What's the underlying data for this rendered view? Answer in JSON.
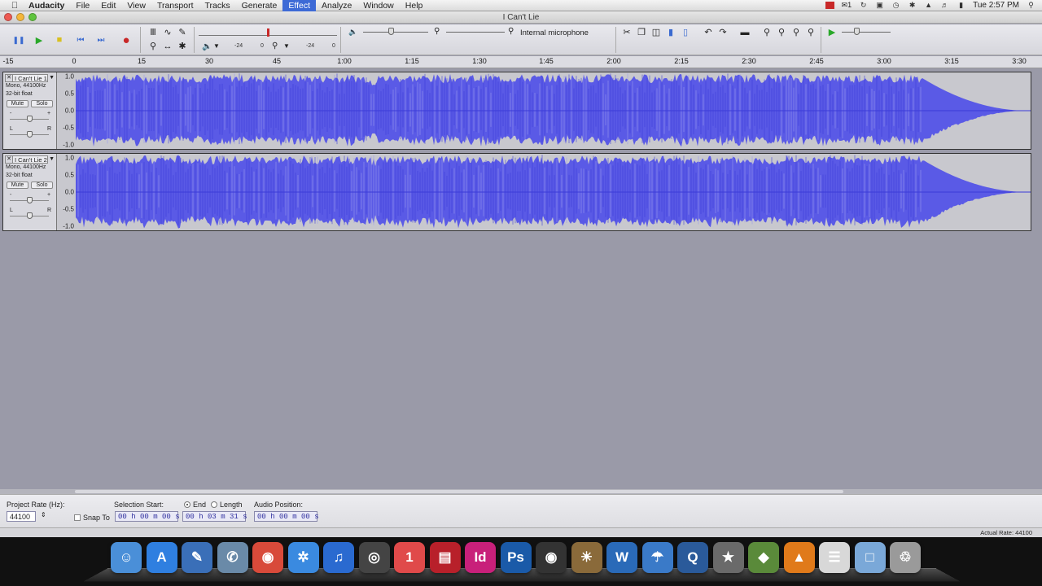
{
  "menubar": {
    "apple_icon": "apple-icon",
    "app_name": "Audacity",
    "menus": [
      "File",
      "Edit",
      "View",
      "Transport",
      "Tracks",
      "Generate",
      "Effect",
      "Analyze",
      "Window",
      "Help"
    ],
    "active_menu": "Effect",
    "status_badge": "1",
    "clock": "Tue 2:57 PM"
  },
  "window": {
    "title": "I Can't Lie"
  },
  "toolbar": {
    "pause_label": "❚❚",
    "play_label": "▶",
    "stop_label": "■",
    "skip_start_label": "⏮",
    "skip_end_label": "⏭",
    "record_label": "●",
    "playback_meter_ticks": [
      "-24",
      "0"
    ],
    "record_meter_ticks": [
      "-24",
      "0"
    ],
    "input_device": "Internal microphone"
  },
  "ruler": {
    "ticks": [
      "-15",
      "0",
      "15",
      "30",
      "45",
      "1:00",
      "1:15",
      "1:30",
      "1:45",
      "2:00",
      "2:15",
      "2:30",
      "2:45",
      "3:00",
      "3:15",
      "3:30"
    ]
  },
  "tracks": [
    {
      "name": "I Can't Lie 1",
      "info1": "Mono, 44100Hz",
      "info2": "32-bit float",
      "mute": "Mute",
      "solo": "Solo",
      "pan_left": "L",
      "pan_right": "R",
      "gain_minus": "-",
      "gain_plus": "+",
      "scale": [
        "1.0",
        "0.5",
        "0.0",
        "-0.5",
        "-1.0"
      ]
    },
    {
      "name": "I Can't Lie 2",
      "info1": "Mono, 44100Hz",
      "info2": "32-bit float",
      "mute": "Mute",
      "solo": "Solo",
      "pan_left": "L",
      "pan_right": "R",
      "gain_minus": "-",
      "gain_plus": "+",
      "scale": [
        "1.0",
        "0.5",
        "0.0",
        "-0.5",
        "-1.0"
      ]
    }
  ],
  "bottom": {
    "project_rate_label": "Project Rate (Hz):",
    "project_rate_value": "44100",
    "snap_to_label": "Snap To",
    "selection_start_label": "Selection Start:",
    "end_label": "End",
    "length_label": "Length",
    "audio_position_label": "Audio Position:",
    "selection_start_value": "00 h 00 m 00 s",
    "end_value": "00 h 03 m 31 s",
    "audio_position_value": "00 h 00 m 00 s"
  },
  "status": {
    "actual_rate": "Actual Rate: 44100"
  },
  "dock": {
    "apps": [
      {
        "name": "finder",
        "glyph": "☺",
        "color": "#4a8fd8"
      },
      {
        "name": "app-store",
        "glyph": "A",
        "color": "#2f7fe0"
      },
      {
        "name": "xcode",
        "glyph": "✎",
        "color": "#3a6fb8"
      },
      {
        "name": "preview",
        "glyph": "✆",
        "color": "#6a8aa8"
      },
      {
        "name": "chrome",
        "glyph": "◉",
        "color": "#d84a3a"
      },
      {
        "name": "safari",
        "glyph": "✲",
        "color": "#3a8ae0"
      },
      {
        "name": "itunes",
        "glyph": "♫",
        "color": "#2a6ad0"
      },
      {
        "name": "camera",
        "glyph": "◎",
        "color": "#444"
      },
      {
        "name": "calendar",
        "glyph": "1",
        "color": "#e04a4a"
      },
      {
        "name": "photo-booth",
        "glyph": "▤",
        "color": "#b8202a"
      },
      {
        "name": "indesign",
        "glyph": "Id",
        "color": "#c8207a"
      },
      {
        "name": "photoshop",
        "glyph": "Ps",
        "color": "#1a5aa8"
      },
      {
        "name": "dvd-player",
        "glyph": "◉",
        "color": "#333"
      },
      {
        "name": "iphoto",
        "glyph": "☀",
        "color": "#8a6a3a"
      },
      {
        "name": "word",
        "glyph": "W",
        "color": "#2a6ab8"
      },
      {
        "name": "weather",
        "glyph": "☂",
        "color": "#3a7ac8"
      },
      {
        "name": "quicktime",
        "glyph": "Q",
        "color": "#2a5a9a"
      },
      {
        "name": "imovie",
        "glyph": "★",
        "color": "#6a6a6a"
      },
      {
        "name": "ibooks",
        "glyph": "◆",
        "color": "#5a8a3a"
      },
      {
        "name": "vlc",
        "glyph": "▲",
        "color": "#e07a1a"
      },
      {
        "name": "documents",
        "glyph": "☰",
        "color": "#d8d8d8"
      },
      {
        "name": "folder",
        "glyph": "□",
        "color": "#7aa8d8"
      },
      {
        "name": "trash",
        "glyph": "♲",
        "color": "#9a9a9a"
      }
    ]
  },
  "colors": {
    "waveform": "#5a5ae6",
    "waveform_edge": "#3a3ad8",
    "active_menu": "#3d6ad6",
    "record": "#c82828",
    "play": "#2aa82a"
  }
}
